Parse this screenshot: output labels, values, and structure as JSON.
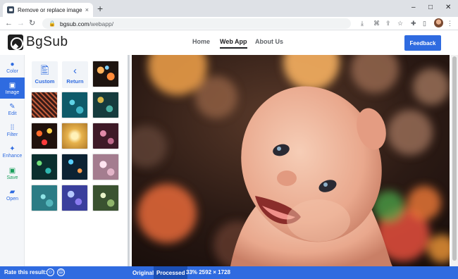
{
  "browser": {
    "tab_title": "Remove or replace image backg",
    "tab_close": "×",
    "new_tab": "+",
    "url_domain": "bgsub.com",
    "url_path": "/webapp/",
    "window_controls": [
      "–",
      "□",
      "✕"
    ]
  },
  "site": {
    "logo_text": "BgSub",
    "nav": [
      "Home",
      "Web App",
      "About Us"
    ],
    "active_nav": "Web App",
    "feedback_label": "Feedback"
  },
  "tools": [
    {
      "label": "Color",
      "icon": "palette-icon",
      "glyph": "🎨",
      "state": "normal"
    },
    {
      "label": "Image",
      "icon": "image-icon",
      "glyph": "🖼",
      "state": "active"
    },
    {
      "label": "Edit",
      "icon": "pencil-icon",
      "glyph": "✎",
      "state": "normal"
    },
    {
      "label": "Filter",
      "icon": "filter-icon",
      "glyph": "⁞",
      "state": "normal"
    },
    {
      "label": "Enhance",
      "icon": "sparkle-icon",
      "glyph": "✦",
      "state": "normal"
    },
    {
      "label": "Save",
      "icon": "save-icon",
      "glyph": "▣",
      "state": "green"
    },
    {
      "label": "Open",
      "icon": "folder-open-icon",
      "glyph": "▰",
      "state": "normal"
    }
  ],
  "panel": {
    "custom_label": "Custom",
    "return_label": "Return",
    "thumbnails": [
      "bokeh-orange-dark",
      "chain-link-fence",
      "teal-bokeh",
      "teal-gold-bokeh",
      "warm-bokeh-lights",
      "golden-glitter",
      "pink-bokeh",
      "green-teal-bokeh",
      "blue-night-bokeh",
      "soft-pink-bokeh",
      "teal-sparkle",
      "blue-purple-bokeh",
      "green-foliage-bokeh"
    ]
  },
  "status": {
    "rate_label": "Rate this result:",
    "happy_face": "☺",
    "sad_face": "☹",
    "view_original": "Original",
    "view_processed": "Processed",
    "zoom_and_size": "33% 2592 × 1728"
  },
  "colors": {
    "accent": "#2f6be0",
    "save_green": "#1a9e5b"
  }
}
